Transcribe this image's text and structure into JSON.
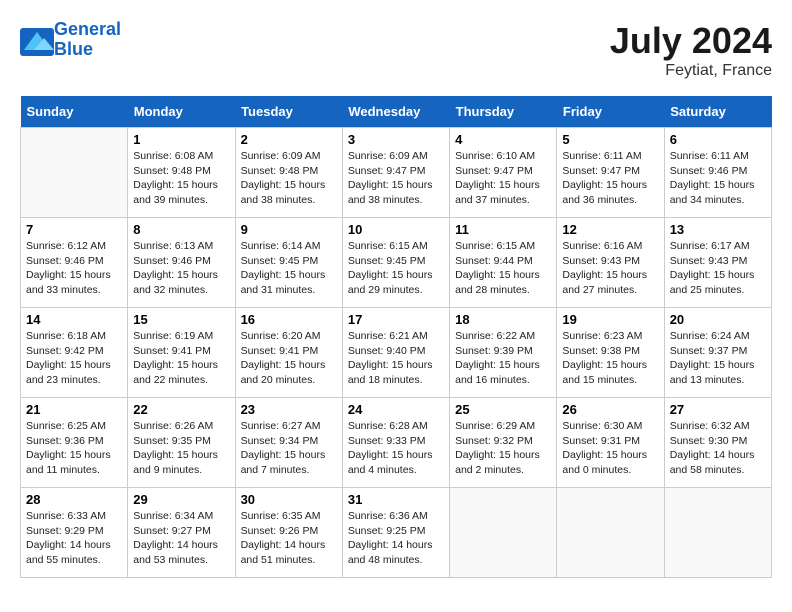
{
  "header": {
    "logo_line1": "General",
    "logo_line2": "Blue",
    "month_year": "July 2024",
    "location": "Feytiat, France"
  },
  "columns": [
    "Sunday",
    "Monday",
    "Tuesday",
    "Wednesday",
    "Thursday",
    "Friday",
    "Saturday"
  ],
  "weeks": [
    [
      {
        "day": "",
        "info": ""
      },
      {
        "day": "1",
        "info": "Sunrise: 6:08 AM\nSunset: 9:48 PM\nDaylight: 15 hours\nand 39 minutes."
      },
      {
        "day": "2",
        "info": "Sunrise: 6:09 AM\nSunset: 9:48 PM\nDaylight: 15 hours\nand 38 minutes."
      },
      {
        "day": "3",
        "info": "Sunrise: 6:09 AM\nSunset: 9:47 PM\nDaylight: 15 hours\nand 38 minutes."
      },
      {
        "day": "4",
        "info": "Sunrise: 6:10 AM\nSunset: 9:47 PM\nDaylight: 15 hours\nand 37 minutes."
      },
      {
        "day": "5",
        "info": "Sunrise: 6:11 AM\nSunset: 9:47 PM\nDaylight: 15 hours\nand 36 minutes."
      },
      {
        "day": "6",
        "info": "Sunrise: 6:11 AM\nSunset: 9:46 PM\nDaylight: 15 hours\nand 34 minutes."
      }
    ],
    [
      {
        "day": "7",
        "info": "Sunrise: 6:12 AM\nSunset: 9:46 PM\nDaylight: 15 hours\nand 33 minutes."
      },
      {
        "day": "8",
        "info": "Sunrise: 6:13 AM\nSunset: 9:46 PM\nDaylight: 15 hours\nand 32 minutes."
      },
      {
        "day": "9",
        "info": "Sunrise: 6:14 AM\nSunset: 9:45 PM\nDaylight: 15 hours\nand 31 minutes."
      },
      {
        "day": "10",
        "info": "Sunrise: 6:15 AM\nSunset: 9:45 PM\nDaylight: 15 hours\nand 29 minutes."
      },
      {
        "day": "11",
        "info": "Sunrise: 6:15 AM\nSunset: 9:44 PM\nDaylight: 15 hours\nand 28 minutes."
      },
      {
        "day": "12",
        "info": "Sunrise: 6:16 AM\nSunset: 9:43 PM\nDaylight: 15 hours\nand 27 minutes."
      },
      {
        "day": "13",
        "info": "Sunrise: 6:17 AM\nSunset: 9:43 PM\nDaylight: 15 hours\nand 25 minutes."
      }
    ],
    [
      {
        "day": "14",
        "info": "Sunrise: 6:18 AM\nSunset: 9:42 PM\nDaylight: 15 hours\nand 23 minutes."
      },
      {
        "day": "15",
        "info": "Sunrise: 6:19 AM\nSunset: 9:41 PM\nDaylight: 15 hours\nand 22 minutes."
      },
      {
        "day": "16",
        "info": "Sunrise: 6:20 AM\nSunset: 9:41 PM\nDaylight: 15 hours\nand 20 minutes."
      },
      {
        "day": "17",
        "info": "Sunrise: 6:21 AM\nSunset: 9:40 PM\nDaylight: 15 hours\nand 18 minutes."
      },
      {
        "day": "18",
        "info": "Sunrise: 6:22 AM\nSunset: 9:39 PM\nDaylight: 15 hours\nand 16 minutes."
      },
      {
        "day": "19",
        "info": "Sunrise: 6:23 AM\nSunset: 9:38 PM\nDaylight: 15 hours\nand 15 minutes."
      },
      {
        "day": "20",
        "info": "Sunrise: 6:24 AM\nSunset: 9:37 PM\nDaylight: 15 hours\nand 13 minutes."
      }
    ],
    [
      {
        "day": "21",
        "info": "Sunrise: 6:25 AM\nSunset: 9:36 PM\nDaylight: 15 hours\nand 11 minutes."
      },
      {
        "day": "22",
        "info": "Sunrise: 6:26 AM\nSunset: 9:35 PM\nDaylight: 15 hours\nand 9 minutes."
      },
      {
        "day": "23",
        "info": "Sunrise: 6:27 AM\nSunset: 9:34 PM\nDaylight: 15 hours\nand 7 minutes."
      },
      {
        "day": "24",
        "info": "Sunrise: 6:28 AM\nSunset: 9:33 PM\nDaylight: 15 hours\nand 4 minutes."
      },
      {
        "day": "25",
        "info": "Sunrise: 6:29 AM\nSunset: 9:32 PM\nDaylight: 15 hours\nand 2 minutes."
      },
      {
        "day": "26",
        "info": "Sunrise: 6:30 AM\nSunset: 9:31 PM\nDaylight: 15 hours\nand 0 minutes."
      },
      {
        "day": "27",
        "info": "Sunrise: 6:32 AM\nSunset: 9:30 PM\nDaylight: 14 hours\nand 58 minutes."
      }
    ],
    [
      {
        "day": "28",
        "info": "Sunrise: 6:33 AM\nSunset: 9:29 PM\nDaylight: 14 hours\nand 55 minutes."
      },
      {
        "day": "29",
        "info": "Sunrise: 6:34 AM\nSunset: 9:27 PM\nDaylight: 14 hours\nand 53 minutes."
      },
      {
        "day": "30",
        "info": "Sunrise: 6:35 AM\nSunset: 9:26 PM\nDaylight: 14 hours\nand 51 minutes."
      },
      {
        "day": "31",
        "info": "Sunrise: 6:36 AM\nSunset: 9:25 PM\nDaylight: 14 hours\nand 48 minutes."
      },
      {
        "day": "",
        "info": ""
      },
      {
        "day": "",
        "info": ""
      },
      {
        "day": "",
        "info": ""
      }
    ]
  ]
}
